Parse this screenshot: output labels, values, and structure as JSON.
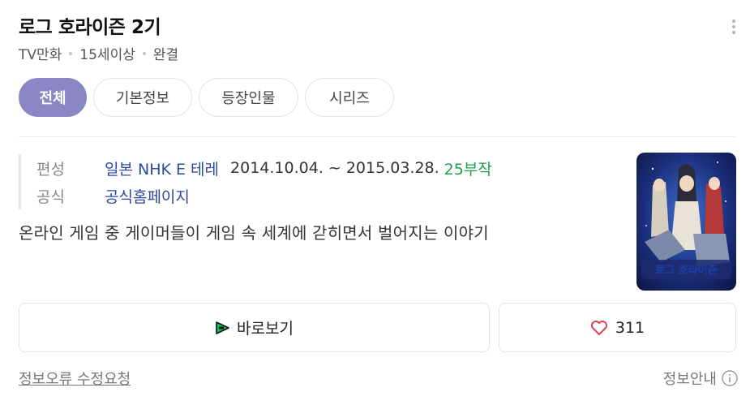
{
  "header": {
    "title": "로그 호라이즌 2기",
    "meta": [
      "TV만화",
      "15세이상",
      "완결"
    ]
  },
  "tabs": [
    {
      "label": "전체",
      "active": true
    },
    {
      "label": "기본정보",
      "active": false
    },
    {
      "label": "등장인물",
      "active": false
    },
    {
      "label": "시리즈",
      "active": false
    }
  ],
  "info": {
    "broadcast_label": "편성",
    "broadcaster": "일본 NHK E 테레",
    "period": "2014.10.04. ~ 2015.03.28.",
    "episodes": "25부작",
    "official_label": "공식",
    "official_link": "공식홈페이지"
  },
  "description": "온라인 게임 중 게이머들이 게임 속 세계에 갇히면서 벌어지는 이야기",
  "poster": {
    "logo_text": "로그 호라이즌"
  },
  "actions": {
    "watch_label": "바로보기",
    "like_count": "311"
  },
  "footer": {
    "report_label": "정보오류 수정요청",
    "info_label": "정보안내"
  },
  "colors": {
    "accent": "#8b87c4",
    "link": "#2d4a9a",
    "episodes": "#1aa14f",
    "heart": "#e0424f"
  }
}
